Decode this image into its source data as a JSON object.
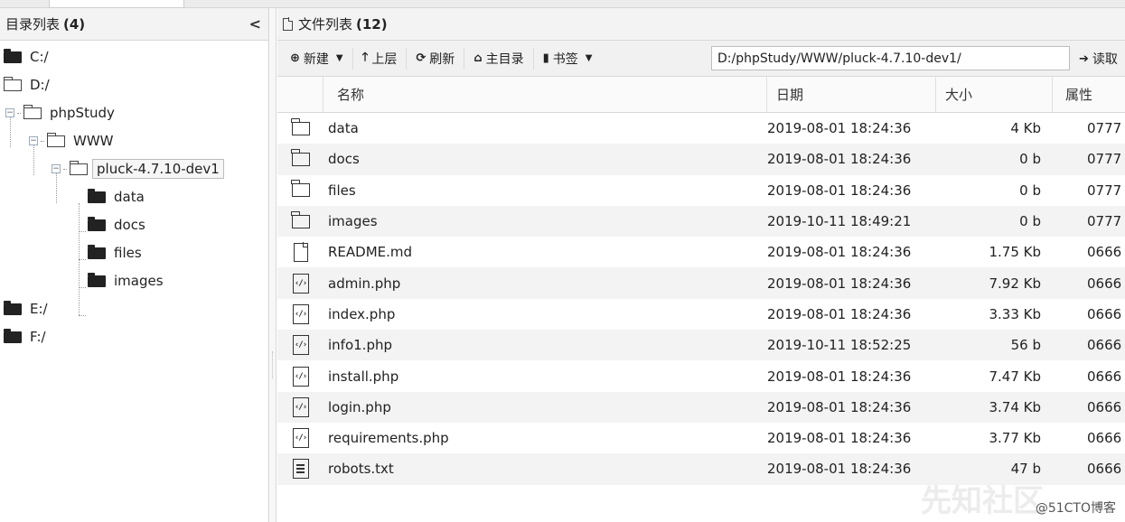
{
  "left_panel": {
    "title": "目录列表",
    "count": "(4)",
    "collapse": "<",
    "tree": {
      "c_drive": "C:/",
      "d_drive": "D:/",
      "phpstudy": "phpStudy",
      "www": "WWW",
      "pluck": "pluck-4.7.10-dev1",
      "data": "data",
      "docs": "docs",
      "files": "files",
      "images": "images",
      "e_drive": "E:/",
      "f_drive": "F:/"
    }
  },
  "right_panel": {
    "title": "文件列表",
    "count": "(12)"
  },
  "toolbar": {
    "new_label": "新建",
    "up_label": "上层",
    "refresh_label": "刷新",
    "home_label": "主目录",
    "bookmark_label": "书签",
    "path_value": "D:/phpStudy/WWW/pluck-4.7.10-dev1/",
    "read_label": "读取"
  },
  "table": {
    "headers": {
      "name": "名称",
      "date": "日期",
      "size": "大小",
      "attr": "属性"
    },
    "rows": [
      {
        "icon": "folder-icon",
        "name": "data",
        "date": "2019-08-01 18:24:36",
        "size": "4 Kb",
        "attr": "0777"
      },
      {
        "icon": "folder-icon",
        "name": "docs",
        "date": "2019-08-01 18:24:36",
        "size": "0 b",
        "attr": "0777"
      },
      {
        "icon": "folder-icon",
        "name": "files",
        "date": "2019-08-01 18:24:36",
        "size": "0 b",
        "attr": "0777"
      },
      {
        "icon": "folder-icon",
        "name": "images",
        "date": "2019-10-11 18:49:21",
        "size": "0 b",
        "attr": "0777"
      },
      {
        "icon": "file-icon",
        "name": "README.md",
        "date": "2019-08-01 18:24:36",
        "size": "1.75 Kb",
        "attr": "0666"
      },
      {
        "icon": "code-file-icon",
        "name": "admin.php",
        "date": "2019-08-01 18:24:36",
        "size": "7.92 Kb",
        "attr": "0666"
      },
      {
        "icon": "code-file-icon",
        "name": "index.php",
        "date": "2019-08-01 18:24:36",
        "size": "3.33 Kb",
        "attr": "0666"
      },
      {
        "icon": "code-file-icon",
        "name": "info1.php",
        "date": "2019-10-11 18:52:25",
        "size": "56 b",
        "attr": "0666"
      },
      {
        "icon": "code-file-icon",
        "name": "install.php",
        "date": "2019-08-01 18:24:36",
        "size": "7.47 Kb",
        "attr": "0666"
      },
      {
        "icon": "code-file-icon",
        "name": "login.php",
        "date": "2019-08-01 18:24:36",
        "size": "3.74 Kb",
        "attr": "0666"
      },
      {
        "icon": "code-file-icon",
        "name": "requirements.php",
        "date": "2019-08-01 18:24:36",
        "size": "3.77 Kb",
        "attr": "0666"
      },
      {
        "icon": "text-file-icon",
        "name": "robots.txt",
        "date": "2019-08-01 18:24:36",
        "size": "47 b",
        "attr": "0666"
      }
    ]
  },
  "watermark": "@51CTO博客",
  "watermark_faint": "先知社区"
}
